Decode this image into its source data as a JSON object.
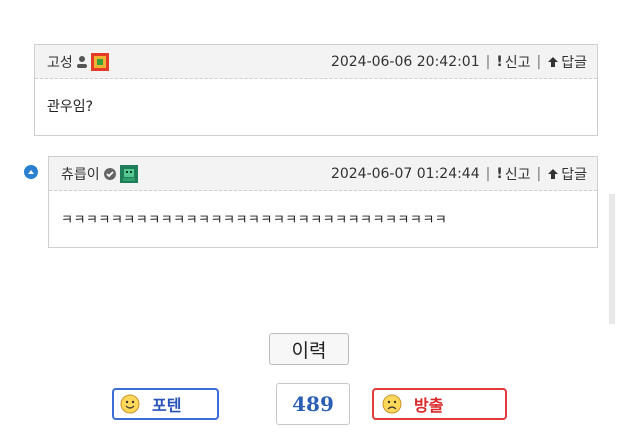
{
  "comments": [
    {
      "author": "고성",
      "timestamp": "2024-06-06 20:42:01",
      "report_label": "신고",
      "reply_label": "답글",
      "text": "관우임?"
    },
    {
      "author": "츄릅이",
      "timestamp": "2024-06-07 01:24:44",
      "report_label": "신고",
      "reply_label": "답글",
      "text": "ㅋㅋㅋㅋㅋㅋㅋㅋㅋㅋㅋㅋㅋㅋㅋㅋㅋㅋㅋㅋㅋㅋㅋㅋㅋㅋㅋㅋㅋㅋㅋ"
    }
  ],
  "history_button": "이력",
  "vote": {
    "up_label": "포텐",
    "count": "489",
    "down_label": "방출"
  },
  "colors": {
    "accent_blue": "#2a7fd1",
    "up": "#3b6dd6",
    "down": "#e13b3b"
  }
}
